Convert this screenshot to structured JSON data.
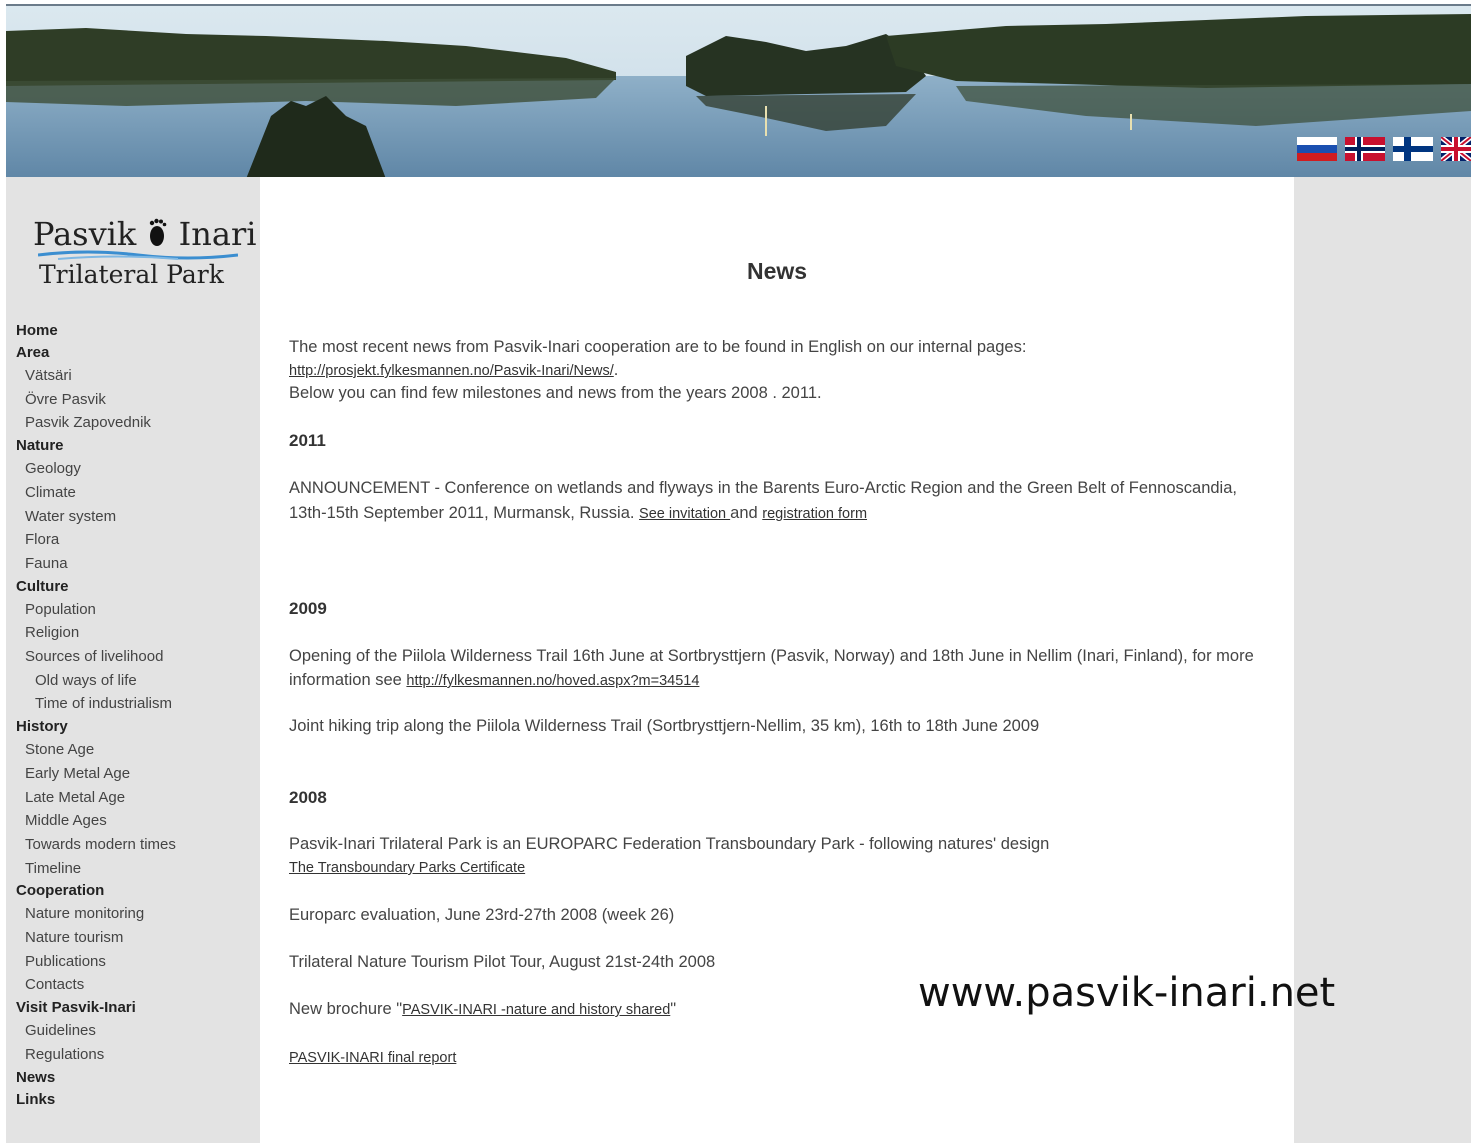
{
  "logo": {
    "line1": "Pasvik",
    "line2": "Inari",
    "line3": "Trilateral Park"
  },
  "languages": [
    "Russian",
    "Norwegian",
    "Finnish",
    "English"
  ],
  "nav": [
    {
      "label": "Home",
      "level": 0
    },
    {
      "label": "Area",
      "level": 0
    },
    {
      "label": "Vätsäri",
      "level": 1
    },
    {
      "label": "Övre Pasvik",
      "level": 1
    },
    {
      "label": "Pasvik Zapovednik",
      "level": 1
    },
    {
      "label": "Nature",
      "level": 0
    },
    {
      "label": "Geology",
      "level": 1
    },
    {
      "label": "Climate",
      "level": 1
    },
    {
      "label": "Water system",
      "level": 1
    },
    {
      "label": "Flora",
      "level": 1
    },
    {
      "label": "Fauna",
      "level": 1
    },
    {
      "label": "Culture",
      "level": 0
    },
    {
      "label": "Population",
      "level": 1
    },
    {
      "label": "Religion",
      "level": 1
    },
    {
      "label": "Sources of livelihood",
      "level": 1
    },
    {
      "label": "Old ways of life",
      "level": 2
    },
    {
      "label": "Time of industrialism",
      "level": 2
    },
    {
      "label": "History",
      "level": 0
    },
    {
      "label": "Stone Age",
      "level": 1
    },
    {
      "label": "Early Metal Age",
      "level": 1
    },
    {
      "label": "Late Metal Age",
      "level": 1
    },
    {
      "label": "Middle Ages",
      "level": 1
    },
    {
      "label": "Towards modern times",
      "level": 1
    },
    {
      "label": "Timeline",
      "level": 1
    },
    {
      "label": "Cooperation",
      "level": 0
    },
    {
      "label": "Nature monitoring",
      "level": 1
    },
    {
      "label": "Nature tourism",
      "level": 1
    },
    {
      "label": "Publications",
      "level": 1
    },
    {
      "label": "Contacts",
      "level": 1
    },
    {
      "label": "Visit Pasvik-Inari",
      "level": 0
    },
    {
      "label": "Guidelines",
      "level": 1
    },
    {
      "label": "Regulations",
      "level": 1
    },
    {
      "label": "News",
      "level": 0
    },
    {
      "label": "Links",
      "level": 0
    }
  ],
  "page": {
    "title": "News",
    "intro_text": "The most recent news from Pasvik-Inari cooperation are to be found in English on our internal pages:",
    "intro_link": "http://prosjekt.fylkesmannen.no/Pasvik-Inari/News/",
    "intro_link_suffix": ".",
    "intro_text2": "Below you can find few milestones and news from the years 2008 . 2011.",
    "y2011": {
      "heading": "2011",
      "text": "ANNOUNCEMENT -  Conference on wetlands and flyways in the Barents Euro-Arctic Region and the Green Belt of Fennoscandia, 13th-15th September 2011, Murmansk, Russia. ",
      "link1": "See invitation ",
      "and": "and ",
      "link2": "registration form"
    },
    "y2009": {
      "heading": "2009",
      "text1": "Opening of the Piilola Wilderness Trail 16th June at Sortbrysttjern (Pasvik, Norway) and 18th June in Nellim (Inari, Finland), for more information see ",
      "link1": "http://fylkesmannen.no/hoved.aspx?m=34514",
      "text2": "Joint hiking trip along the Piilola Wilderness Trail (Sortbrysttjern-Nellim, 35 km), 16th to 18th June 2009"
    },
    "y2008": {
      "heading": "2008",
      "text1": "Pasvik-Inari Trilateral Park is an EUROPARC Federation Transboundary Park - following natures' design",
      "link1": "The Transboundary Parks Certificate",
      "text2": "Europarc evaluation, June 23rd-27th 2008 (week 26)",
      "text3": "Trilateral Nature Tourism Pilot Tour, August 21st-24th 2008",
      "text4_pre": "New brochure \"",
      "link2": "PASVIK-INARI -nature and history shared",
      "text4_post": "\"",
      "link3": "PASVIK-INARI final report"
    }
  },
  "overlay_url": "www.pasvik-inari.net"
}
